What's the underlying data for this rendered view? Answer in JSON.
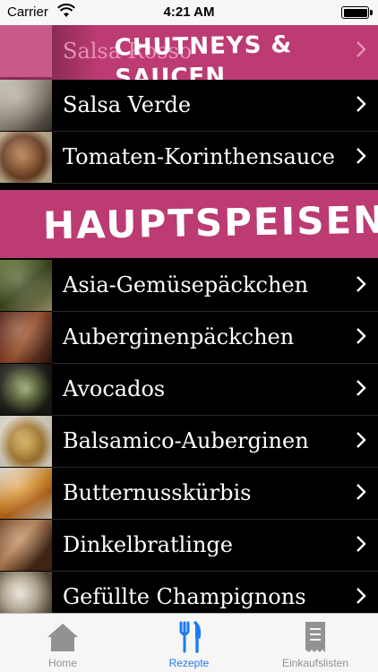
{
  "status_bar": {
    "carrier": "Carrier",
    "time": "4:21 AM",
    "battery_level": 1.0
  },
  "sections": [
    {
      "title": "Chutneys & Saucen",
      "partially_hidden_item": "Salsa Rosso",
      "items": [
        "Salsa Verde",
        "Tomaten-Korinthensauce"
      ]
    },
    {
      "title": "Hauptspeisen",
      "items": [
        "Asia-Gemüsepäckchen",
        "Auberginenpäckchen",
        "Avocados",
        "Balsamico-Auberginen",
        "Butternusskürbis",
        "Dinkelbratlinge",
        "Gefüllte Champignons"
      ]
    }
  ],
  "tabs": [
    {
      "label": "Home",
      "icon": "house-icon",
      "active": false
    },
    {
      "label": "Rezepte",
      "icon": "fork-knife-icon",
      "active": true
    },
    {
      "label": "Einkaufslisten",
      "icon": "receipt-icon",
      "active": false
    }
  ],
  "colors": {
    "banner": "#bc3b72",
    "list_background": "#000000",
    "active_tab": "#1e7cf2",
    "inactive_tab": "#929292"
  }
}
